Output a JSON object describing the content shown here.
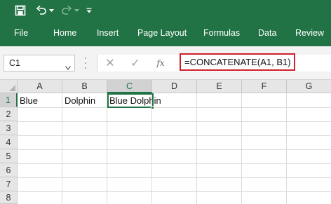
{
  "quick_access": {
    "icons": [
      "save-icon",
      "undo-icon",
      "undo-dropdown-icon",
      "redo-icon",
      "redo-dropdown-icon",
      "customize-qat-icon"
    ]
  },
  "ribbon": {
    "tabs": [
      {
        "label": "File"
      },
      {
        "label": "Home"
      },
      {
        "label": "Insert"
      },
      {
        "label": "Page Layout"
      },
      {
        "label": "Formulas"
      },
      {
        "label": "Data"
      },
      {
        "label": "Review"
      }
    ]
  },
  "formula_bar": {
    "name_box": "C1",
    "cancel_symbol": "✕",
    "enter_symbol": "✓",
    "fx_label": "fx",
    "formula": "=CONCATENATE(A1, B1)"
  },
  "sheet": {
    "columns": [
      "A",
      "B",
      "C",
      "D",
      "E",
      "F",
      "G"
    ],
    "rows": [
      "1",
      "2",
      "3",
      "4",
      "5",
      "6",
      "7",
      "8"
    ],
    "active_cell": "C1",
    "cells": {
      "A1": "Blue",
      "B1": "Dolphin",
      "C1": "Blue Dolphin"
    }
  },
  "colors": {
    "accent": "#217346",
    "highlight_border": "#d0202a"
  }
}
